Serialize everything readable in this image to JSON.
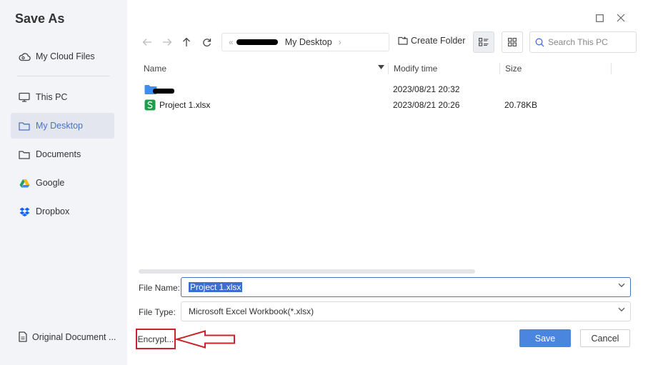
{
  "dialog": {
    "title": "Save As"
  },
  "sidebar": {
    "items": [
      {
        "label": "My Cloud Files",
        "icon": "cloud-icon"
      },
      {
        "label": "This PC",
        "icon": "monitor-icon"
      },
      {
        "label": "My Desktop",
        "icon": "folder-icon",
        "active": true
      },
      {
        "label": "Documents",
        "icon": "folder-icon"
      },
      {
        "label": "Google",
        "icon": "google-drive-icon"
      },
      {
        "label": "Dropbox",
        "icon": "dropbox-icon"
      }
    ],
    "bottom_label": "Original Document ..."
  },
  "toolbar": {
    "path_current": "My Desktop",
    "create_folder_label": "Create Folder",
    "search_placeholder": "Search This PC"
  },
  "file_list": {
    "columns": {
      "name": "Name",
      "modify_time": "Modify time",
      "size": "Size"
    },
    "rows": [
      {
        "name": "",
        "type": "folder",
        "modify_time": "2023/08/21 20:32",
        "size": ""
      },
      {
        "name": "Project 1.xlsx",
        "type": "spreadsheet",
        "modify_time": "2023/08/21 20:26",
        "size": "20.78KB"
      }
    ]
  },
  "form": {
    "file_name_label": "File Name:",
    "file_name_value": "Project 1.xlsx",
    "file_type_label": "File Type:",
    "file_type_value": "Microsoft Excel Workbook(*.xlsx)"
  },
  "buttons": {
    "encrypt_label": "Encrypt...",
    "save_label": "Save",
    "cancel_label": "Cancel"
  },
  "colors": {
    "accent": "#4a85e0",
    "active_text": "#4a72c4",
    "annotation_red": "#c9242b",
    "folder_blue": "#3d8ef0",
    "spreadsheet_green": "#1e9e4a"
  }
}
